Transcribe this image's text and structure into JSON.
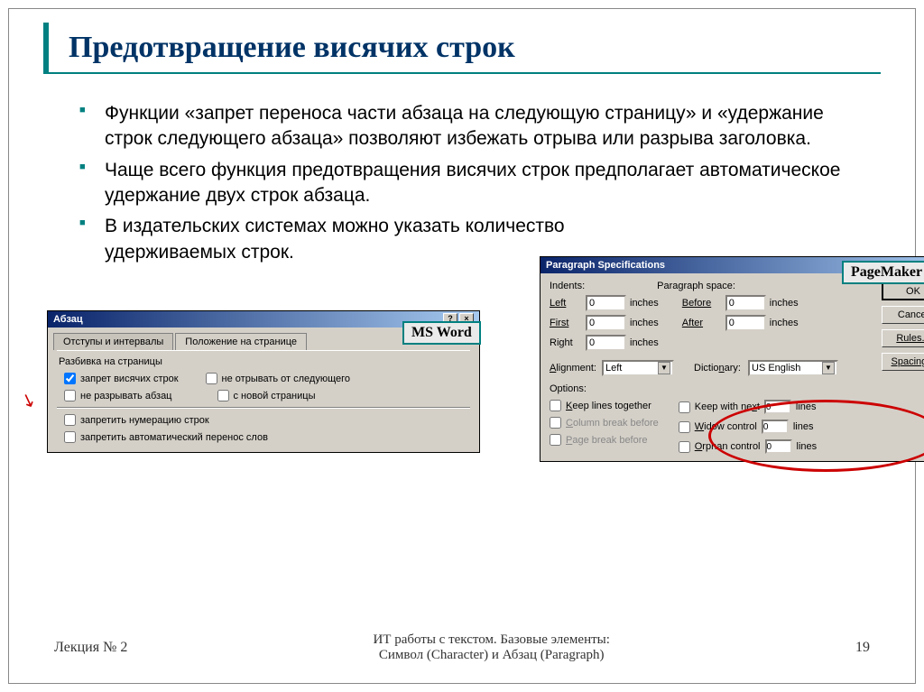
{
  "title": "Предотвращение висячих строк",
  "bullets": [
    "Функции «запрет переноса части абзаца на следующую страницу» и «удержание строк следующего абзаца» позволяют избежать отрыва или разрыва заголовка.",
    "Чаще всего функция предотвращения висячих строк предполагает автоматическое удержание двух строк абзаца.",
    "В издательских системах можно указать количество"
  ],
  "bullet_tail": "удерживаемых строк.",
  "badge_word": "MS Word",
  "badge_pm": "PageMaker",
  "word": {
    "title": "Абзац",
    "tab1": "Отступы и интервалы",
    "tab2": "Положение на странице",
    "group": "Разбивка на страницы",
    "chk1": "запрет висячих строк",
    "chk2": "не отрывать от следующего",
    "chk3": "не разрывать абзац",
    "chk4": "с новой страницы",
    "chk5": "запретить нумерацию строк",
    "chk6": "запретить автоматический перенос слов"
  },
  "pm": {
    "title": "Paragraph Specifications",
    "indents": "Indents:",
    "pspace": "Paragraph space:",
    "left": "Left",
    "first": "First",
    "right": "Right",
    "before": "Before",
    "after": "After",
    "val0": "0",
    "inches": "inches",
    "alignment": "Alignment:",
    "align_val": "Left",
    "dict": "Dictionary:",
    "dict_val": "US English",
    "options": "Options:",
    "keep_lines": "Keep lines together",
    "col_break": "Column break before",
    "page_break": "Page break before",
    "keep_next": "Keep with next",
    "widow": "Widow control",
    "orphan": "Orphan control",
    "lines": "lines",
    "ok": "OK",
    "cancel": "Cancel",
    "rules": "Rules...",
    "spacing": "Spacing..."
  },
  "footer": {
    "left": "Лекция № 2",
    "center1": "ИТ работы с текстом. Базовые элементы:",
    "center2": "Символ (Character) и Абзац (Paragraph)",
    "page": "19"
  }
}
